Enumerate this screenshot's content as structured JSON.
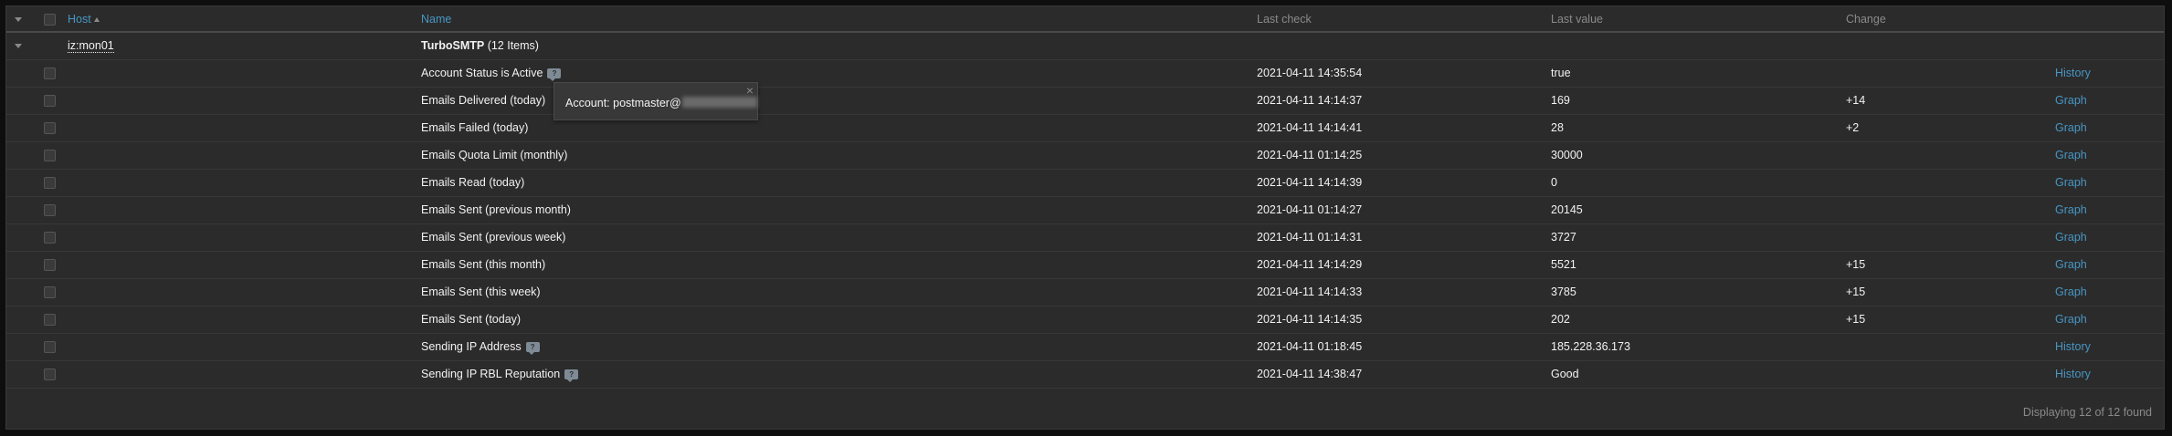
{
  "header": {
    "host": "Host",
    "name": "Name",
    "last_check": "Last check",
    "last_value": "Last value",
    "change": "Change"
  },
  "group": {
    "host": "iz:mon01",
    "name": "TurboSMTP",
    "count": "(12 Items)"
  },
  "items": [
    {
      "name": "Account Status is Active",
      "hint": true,
      "last_check": "2021-04-11 14:35:54",
      "last_value": "true",
      "change": "",
      "link": "History"
    },
    {
      "name": "Emails Delivered (today)",
      "hint": false,
      "last_check": "2021-04-11 14:14:37",
      "last_value": "169",
      "change": "+14",
      "link": "Graph"
    },
    {
      "name": "Emails Failed (today)",
      "hint": false,
      "last_check": "2021-04-11 14:14:41",
      "last_value": "28",
      "change": "+2",
      "link": "Graph"
    },
    {
      "name": "Emails Quota Limit (monthly)",
      "hint": false,
      "last_check": "2021-04-11 01:14:25",
      "last_value": "30000",
      "change": "",
      "link": "Graph"
    },
    {
      "name": "Emails Read (today)",
      "hint": false,
      "last_check": "2021-04-11 14:14:39",
      "last_value": "0",
      "change": "",
      "link": "Graph"
    },
    {
      "name": "Emails Sent (previous month)",
      "hint": false,
      "last_check": "2021-04-11 01:14:27",
      "last_value": "20145",
      "change": "",
      "link": "Graph"
    },
    {
      "name": "Emails Sent (previous week)",
      "hint": false,
      "last_check": "2021-04-11 01:14:31",
      "last_value": "3727",
      "change": "",
      "link": "Graph"
    },
    {
      "name": "Emails Sent (this month)",
      "hint": false,
      "last_check": "2021-04-11 14:14:29",
      "last_value": "5521",
      "change": "+15",
      "link": "Graph"
    },
    {
      "name": "Emails Sent (this week)",
      "hint": false,
      "last_check": "2021-04-11 14:14:33",
      "last_value": "3785",
      "change": "+15",
      "link": "Graph"
    },
    {
      "name": "Emails Sent (today)",
      "hint": false,
      "last_check": "2021-04-11 14:14:35",
      "last_value": "202",
      "change": "+15",
      "link": "Graph"
    },
    {
      "name": "Sending IP Address",
      "hint": true,
      "last_check": "2021-04-11 01:18:45",
      "last_value": "185.228.36.173",
      "change": "",
      "link": "History"
    },
    {
      "name": "Sending IP RBL Reputation",
      "hint": true,
      "last_check": "2021-04-11 14:38:47",
      "last_value": "Good",
      "change": "",
      "link": "History"
    }
  ],
  "popup": {
    "text": "Account: postmaster@",
    "close": "×"
  },
  "footer": "Displaying 12 of 12 found",
  "colors": {
    "background": "#2b2b2b",
    "link": "#4796c4",
    "text": "#f2f2f2",
    "muted": "#8a8a8a"
  }
}
